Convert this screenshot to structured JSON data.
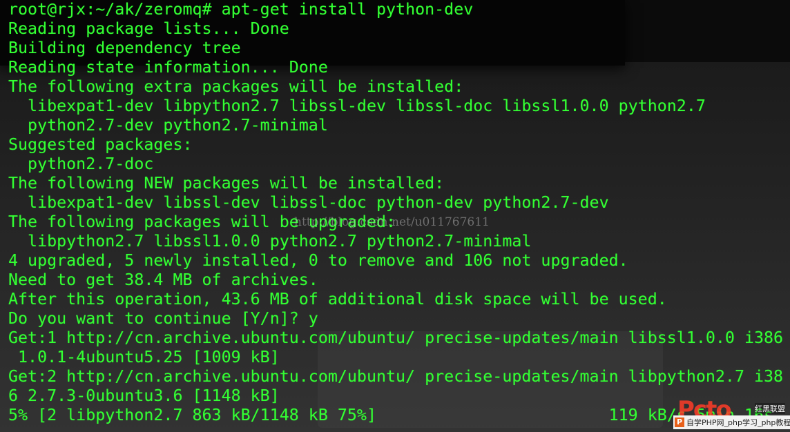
{
  "terminal": {
    "prompt": "root@rjx:~/ak/zeromq# ",
    "command": "apt-get install python-dev",
    "lines": [
      "Reading package lists... Done",
      "Building dependency tree",
      "Reading state information... Done",
      "The following extra packages will be installed:",
      "  libexpat1-dev libpython2.7 libssl-dev libssl-doc libssl1.0.0 python2.7",
      "  python2.7-dev python2.7-minimal",
      "Suggested packages:",
      "  python2.7-doc",
      "The following NEW packages will be installed:",
      "  libexpat1-dev libssl-dev libssl-doc python-dev python2.7-dev",
      "The following packages will be upgraded:",
      "  libpython2.7 libssl1.0.0 python2.7 python2.7-minimal",
      "4 upgraded, 5 newly installed, 0 to remove and 106 not upgraded.",
      "Need to get 38.4 MB of archives.",
      "After this operation, 43.6 MB of additional disk space will be used.",
      "Do you want to continue [Y/n]? y",
      "Get:1 http://cn.archive.ubuntu.com/ubuntu/ precise-updates/main libssl1.0.0 i386",
      " 1.0.1-4ubuntu5.25 [1009 kB]",
      "Get:2 http://cn.archive.ubuntu.com/ubuntu/ precise-updates/main libpython2.7 i38",
      "6 2.7.3-0ubuntu3.6 [1148 kB]",
      "5% [2 libpython2.7 863 kB/1148 kB 75%]                        119 kB/s 5min 16s"
    ],
    "text_color": "#33ff33"
  },
  "overlays": {
    "watermark": "http://blog.csdn.net/u011767611",
    "logo_text": "Pcto",
    "logo_small": "红黑联盟",
    "logo_bar": "自学PHP网_php学习_php教程",
    "logo_bar_icon": "P"
  }
}
